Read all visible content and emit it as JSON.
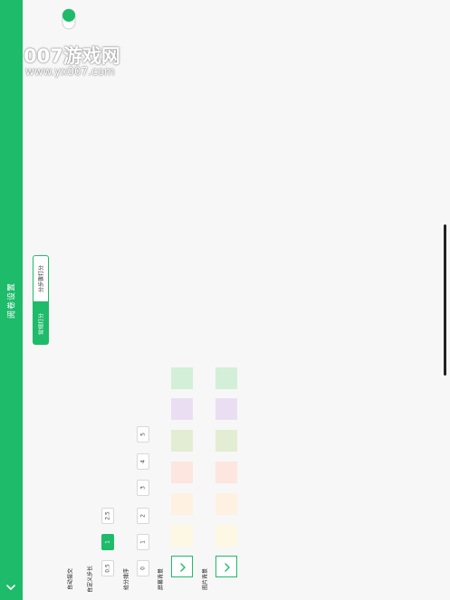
{
  "sidebar": {
    "title": "阅卷设置"
  },
  "watermark": {
    "line1": "007游戏网",
    "line2": "www.yx007.com"
  },
  "mode_tabs": {
    "stepwise_label": "分步骤打分",
    "regular_label": "常规打分",
    "selected": "常规打分"
  },
  "rows": {
    "auto_submit_label": "自动提交",
    "custom_step_label": "自定义步长",
    "score_order_label": "给分排序",
    "screen_bg_label": "屏幕背景",
    "image_bg_label": "图片背景"
  },
  "step_options": [
    "0.5",
    "1",
    "2.5"
  ],
  "step_selected": "1",
  "score_options": [
    "0",
    "1",
    "2",
    "3",
    "4",
    "5"
  ],
  "colors": {
    "accent": "#1dbb6a",
    "swatches": [
      "#ffffff",
      "#fcf8e3",
      "#fff1e1",
      "#fde6e0",
      "#e3edd3",
      "#eadff2",
      "#d3efd7"
    ]
  },
  "icons": {
    "sidebar_toggle": "chevron-down-icon",
    "swatch_selected": "check-icon"
  }
}
